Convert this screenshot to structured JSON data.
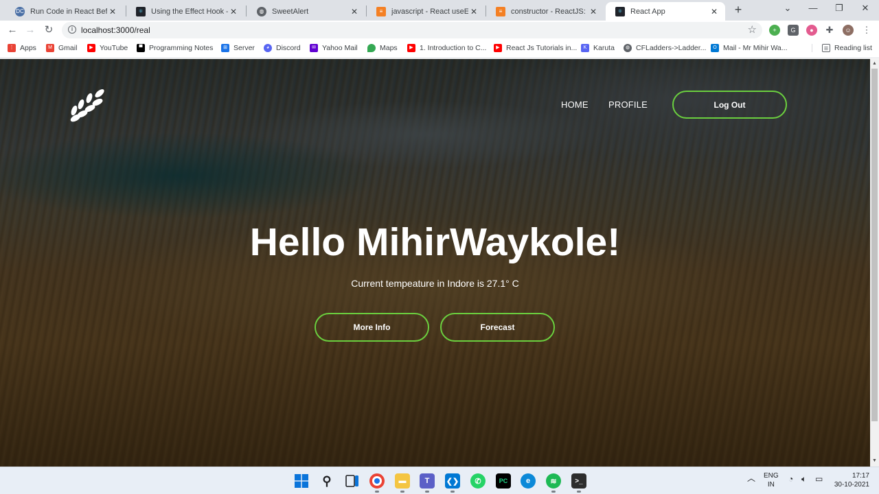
{
  "browser": {
    "tabs": [
      {
        "title": "Run Code in React Before R",
        "favicon_color": "#4a6fa5",
        "active": false
      },
      {
        "title": "Using the Effect Hook – Rea",
        "favicon_color": "#20232a",
        "active": false
      },
      {
        "title": "SweetAlert",
        "favicon_color": "#5f6368",
        "active": false
      },
      {
        "title": "javascript - React useEffect",
        "favicon_color": "#f48024",
        "active": false
      },
      {
        "title": "constructor - ReactJS: Warn",
        "favicon_color": "#f48024",
        "active": false
      },
      {
        "title": "React App",
        "favicon_color": "#20232a",
        "active": true
      }
    ],
    "url": "localhost:3000/real",
    "bookmarks": [
      {
        "label": "Apps",
        "color": "#e94235"
      },
      {
        "label": "Gmail",
        "color": "#ea4335"
      },
      {
        "label": "YouTube",
        "color": "#ff0000"
      },
      {
        "label": "Programming Notes",
        "color": "#000000"
      },
      {
        "label": "Server",
        "color": "#1a73e8"
      },
      {
        "label": "Discord",
        "color": "#5865f2"
      },
      {
        "label": "Yahoo Mail",
        "color": "#6001d2"
      },
      {
        "label": "Maps",
        "color": "#34a853"
      },
      {
        "label": "1. Introduction to C...",
        "color": "#ff0000"
      },
      {
        "label": "React Js Tutorials in...",
        "color": "#ff0000"
      },
      {
        "label": "Karuta",
        "color": "#5865f2"
      },
      {
        "label": "CFLadders->Ladder...",
        "color": "#5f6368"
      },
      {
        "label": "Mail - Mr Mihir Wa...",
        "color": "#0078d4"
      }
    ],
    "reading_list": "Reading list"
  },
  "app": {
    "nav": {
      "home": "HOME",
      "profile": "PROFILE",
      "logout": "Log Out"
    },
    "hero": {
      "title": "Hello MihirWaykole!",
      "subtitle": "Current tempeature in Indore is 27.1° C",
      "more_info": "More Info",
      "forecast": "Forecast"
    },
    "accent_color": "#6bd03f"
  },
  "taskbar": {
    "language": "ENG",
    "region": "IN",
    "time": "17:17",
    "date": "30-10-2021"
  }
}
